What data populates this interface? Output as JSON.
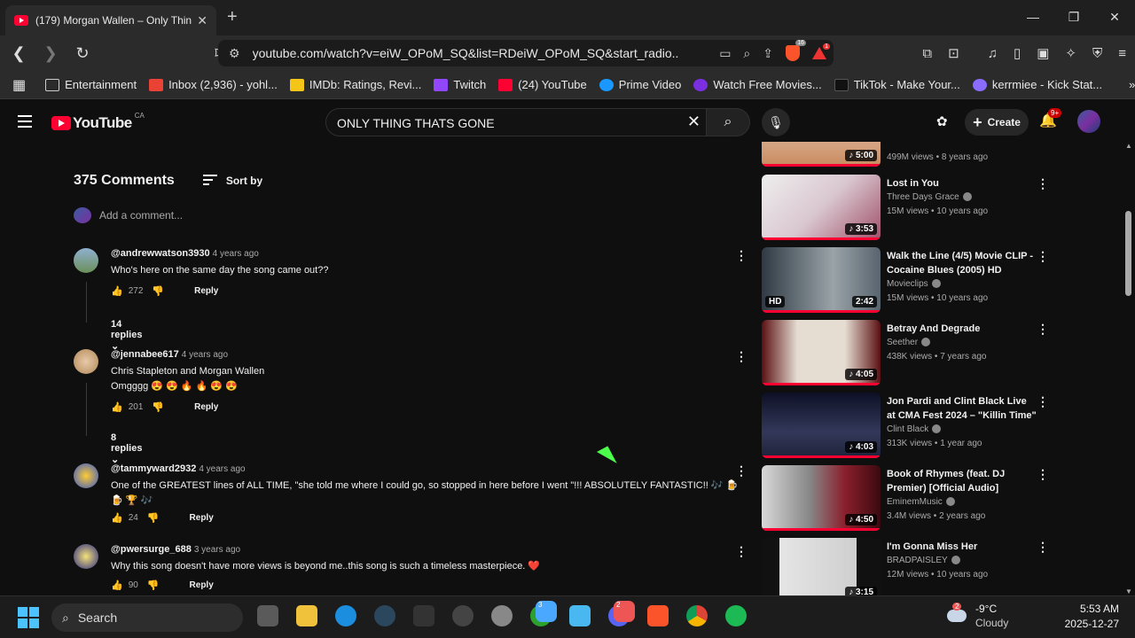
{
  "browser": {
    "tab_title": "(179) Morgan Wallen – Only Thin",
    "url": "youtube.com/watch?v=eiW_OPoM_SQ&list=RDeiW_OPoM_SQ&start_radio...",
    "brave_badge": "16",
    "rewards_badge": "1",
    "bookmarks": [
      {
        "label": "Entertainment",
        "icon": "folder-icon",
        "color": "#cccccc"
      },
      {
        "label": "Inbox (2,936) - yohl...",
        "icon": "gmail-icon",
        "color": "#ea4335"
      },
      {
        "label": "IMDb: Ratings, Revi...",
        "icon": "imdb-icon",
        "color": "#f5c518"
      },
      {
        "label": "Twitch",
        "icon": "twitch-icon",
        "color": "#9146ff"
      },
      {
        "label": "(24) YouTube",
        "icon": "youtube-icon",
        "color": "#ff0033"
      },
      {
        "label": "Prime Video",
        "icon": "prime-icon",
        "color": "#1a98ff"
      },
      {
        "label": "Watch Free Movies...",
        "icon": "movies-icon",
        "color": "#7b2fe0"
      },
      {
        "label": "TikTok - Make Your...",
        "icon": "tiktok-icon",
        "color": "#111111"
      },
      {
        "label": "kerrmiee - Kick Stat...",
        "icon": "kick-icon",
        "color": "#8a6cff"
      }
    ]
  },
  "youtube": {
    "logo_text": "YouTube",
    "country": "CA",
    "search_value": "ONLY THING THATS GONE",
    "create_label": "Create",
    "notif_count": "9+"
  },
  "comments": {
    "count_label": "375 Comments",
    "sort_label": "Sort by",
    "add_placeholder": "Add a comment...",
    "reply_label": "Reply",
    "items": [
      {
        "user": "@andrewwatson3930",
        "ago": "4 years ago",
        "text": "Who's here on the same day the song came out??",
        "likes": "272",
        "replies": "14 replies",
        "avatar_color": "#6b8f5a"
      },
      {
        "user": "@jennabee617",
        "ago": "4 years ago",
        "text": "Chris Stapleton and Morgan Wallen",
        "text2": "Omgggg 😍 😍 🔥 🔥 😍 😍",
        "likes": "201",
        "replies": "8 replies",
        "avatar_color": "#c9a27a"
      },
      {
        "user": "@tammyward2932",
        "ago": "4 years ago",
        "text": "One of  the GREATEST lines of ALL TIME,  \"she told me where I could go,  so stopped in here before I went \"!!!  ABSOLUTELY FANTASTIC!!  🎶 🍺",
        "text2": "🍺 🏆 🎶",
        "likes": "24",
        "avatar_color": "#3355cc"
      },
      {
        "user": "@pwersurge_688",
        "ago": "3 years ago",
        "text": "Why this song doesn't have more views is beyond me..this song is such a timeless masterpiece. ❤️",
        "likes": "90",
        "avatar_color": "#d4b84a"
      }
    ]
  },
  "sidebar": {
    "videos": [
      {
        "title": "",
        "channel": "",
        "stats": "499M views • 8 years ago",
        "duration": "5:00",
        "thumb": "#c98a5e"
      },
      {
        "title": "Lost in You",
        "channel": "Three Days Grace",
        "stats": "15M views • 10 years ago",
        "duration": "3:53",
        "thumb": "#d9c7cf"
      },
      {
        "title": "Walk the Line (4/5) Movie CLIP - Cocaine Blues (2005) HD",
        "channel": "Movieclips",
        "stats": "15M views • 10 years ago",
        "duration": "2:42",
        "hd": "HD",
        "thumb": "#58646e"
      },
      {
        "title": "Betray And Degrade",
        "channel": "Seether",
        "stats": "438K views • 7 years ago",
        "duration": "4:05",
        "thumb": "#c8c0b8"
      },
      {
        "title": "Jon Pardi and Clint Black Live at CMA Fest 2024 – \"Killin Time\"",
        "channel": "Clint Black",
        "stats": "313K views • 1 year ago",
        "duration": "4:03",
        "thumb": "#1e2238"
      },
      {
        "title": "Book of Rhymes (feat. DJ Premier) [Official Audio]",
        "channel": "EminemMusic",
        "stats": "3.4M views • 2 years ago",
        "duration": "4:50",
        "thumb": "#8a1f2c"
      },
      {
        "title": "I'm Gonna Miss Her",
        "channel": "BRADPAISLEY",
        "stats": "12M views • 10 years ago",
        "duration": "3:15",
        "thumb": "#dcdcdc"
      }
    ]
  },
  "taskbar": {
    "search_label": "Search",
    "temp": "-9°C",
    "condition": "Cloudy",
    "weather_badge": "2",
    "time": "5:53 AM",
    "date": "2025-12-27",
    "apps": [
      {
        "name": "task-view-icon",
        "color": "#5a5a5a"
      },
      {
        "name": "file-explorer-icon",
        "color": "#f0c23b"
      },
      {
        "name": "edge-icon",
        "color": "#1c8ee0"
      },
      {
        "name": "steam-icon",
        "color": "#2a475e"
      },
      {
        "name": "epic-games-icon",
        "color": "#333333"
      },
      {
        "name": "obs-icon",
        "color": "#444444"
      },
      {
        "name": "app-icon",
        "color": "#888888"
      },
      {
        "name": "xbox-icon",
        "color": "#2da02d",
        "badge": "3"
      },
      {
        "name": "notepad-icon",
        "color": "#4ab8f0"
      },
      {
        "name": "discord-icon",
        "color": "#5865f2",
        "badge": "2"
      },
      {
        "name": "brave-icon",
        "color": "#fb542b"
      },
      {
        "name": "chrome-icon",
        "color": "#e8b21d"
      },
      {
        "name": "spotify-icon",
        "color": "#1db954"
      }
    ]
  }
}
